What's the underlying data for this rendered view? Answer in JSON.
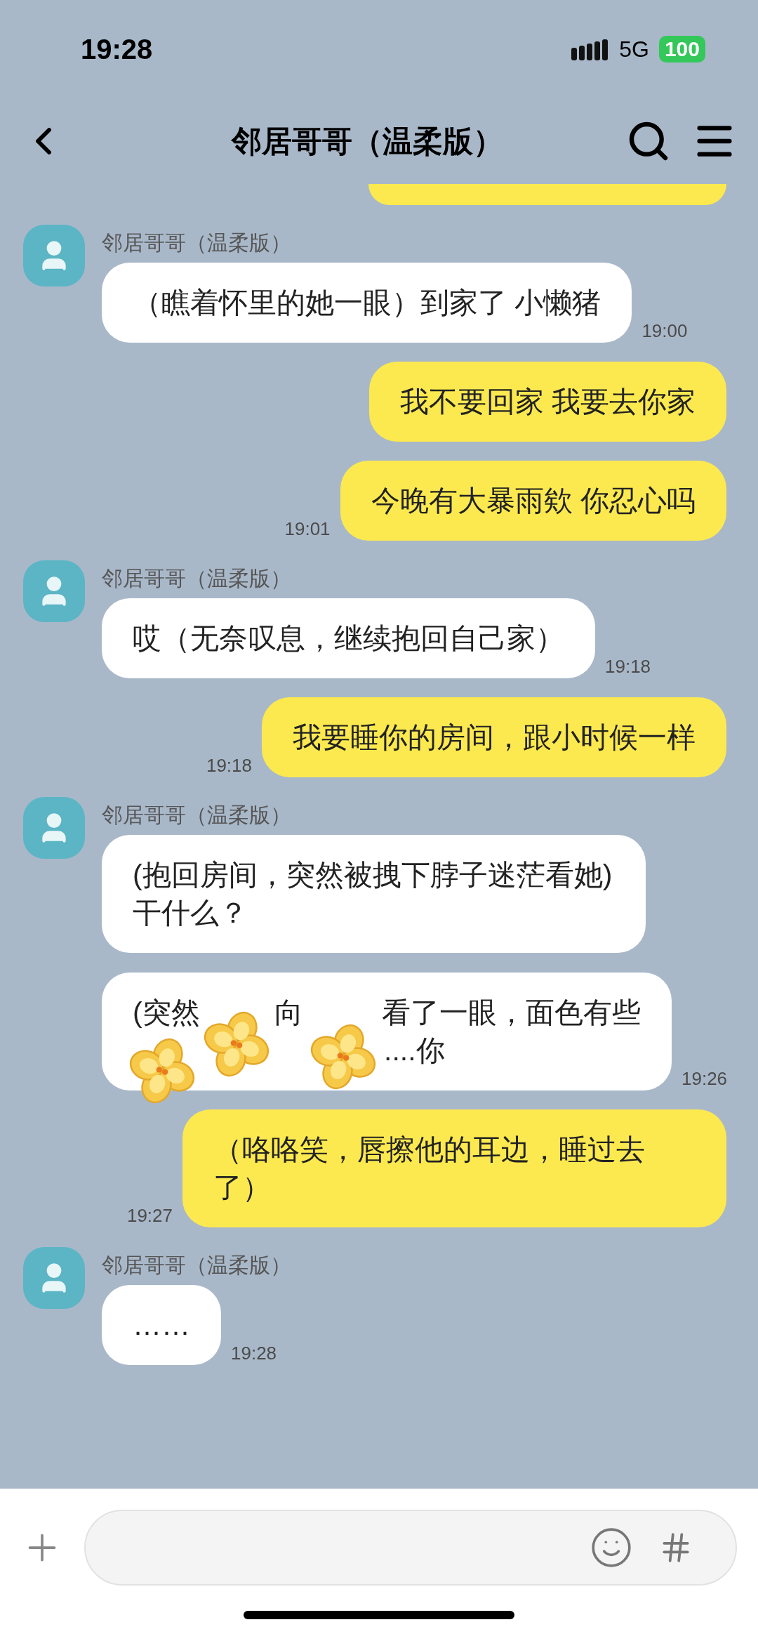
{
  "status_bar": {
    "time": "19:28",
    "network": "5G",
    "battery": "100"
  },
  "header": {
    "title": "邻居哥哥（温柔版）"
  },
  "messages": [
    {
      "kind": "cut_off"
    },
    {
      "kind": "received",
      "sender": "邻居哥哥（温柔版）",
      "bubbles": [
        {
          "text": "（瞧着怀里的她一眼）到家了 小懒猪",
          "time": "19:00"
        }
      ]
    },
    {
      "kind": "sent",
      "bubbles": [
        {
          "text": "我不要回家 我要去你家"
        }
      ]
    },
    {
      "kind": "sent",
      "bubbles": [
        {
          "text": "今晚有大暴雨欸 你忍心吗",
          "time": "19:01"
        }
      ]
    },
    {
      "kind": "received",
      "sender": "邻居哥哥（温柔版）",
      "bubbles": [
        {
          "text": "哎（无奈叹息，继续抱回自己家）",
          "time": "19:18"
        }
      ]
    },
    {
      "kind": "sent",
      "bubbles": [
        {
          "text": "我要睡你的房间，跟小时候一样",
          "time": "19:18"
        }
      ]
    },
    {
      "kind": "received",
      "sender": "邻居哥哥（温柔版）",
      "bubbles": [
        {
          "text": "(抱回房间，突然被拽下脖子迷茫看她) 干什么？"
        },
        {
          "lines": [
            [
              "(突然",
              "向",
              "看了一眼，面色有些"
            ],
            [
              "....你"
            ]
          ],
          "stickers": [
            {
              "kind": "flower"
            },
            {
              "kind": "flower"
            },
            {
              "kind": "flower"
            }
          ],
          "time": "19:26"
        }
      ]
    },
    {
      "kind": "sent",
      "bubbles": [
        {
          "text": "（咯咯笑，唇擦他的耳边，睡过去了）",
          "time": "19:27"
        }
      ]
    },
    {
      "kind": "received",
      "sender": "邻居哥哥（温柔版）",
      "bubbles": [
        {
          "text": "……",
          "time": "19:28"
        }
      ]
    }
  ]
}
